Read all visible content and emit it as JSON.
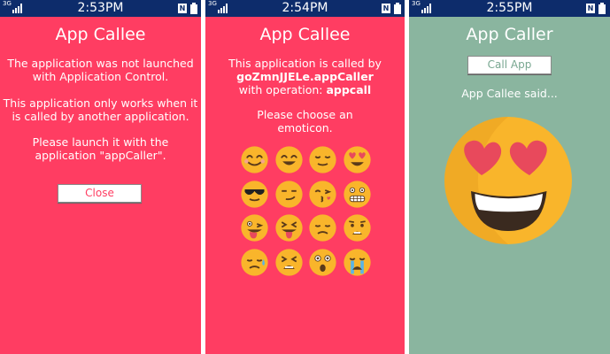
{
  "colors": {
    "callee_bg": "#ff3d62",
    "caller_bg": "#8ab59f",
    "statusbar": "#0d2c6b",
    "emoji_face": "#f9b52b",
    "heart": "#e8495c"
  },
  "screens": [
    {
      "statusbar": {
        "network": "3G",
        "time": "2:53PM",
        "n_badge": "N"
      },
      "title": "App Callee",
      "messages": [
        "The application was not launched",
        "with Application Control.",
        "This application only works when it",
        "is called by another application.",
        "Please launch it with the",
        "application \"appCaller\"."
      ],
      "button": "Close"
    },
    {
      "statusbar": {
        "network": "3G",
        "time": "2:54PM",
        "n_badge": "N"
      },
      "title": "App Callee",
      "line1": "This application is called by",
      "caller_id": "goZmnJJELe.appCaller",
      "operation_prefix": "with operation: ",
      "operation": "appcall",
      "prompt_line1": "Please choose an",
      "prompt_line2": "emoticon.",
      "emoticons": [
        "smiling-face-icon",
        "happy-face-icon",
        "relieved-face-icon",
        "heart-eyes-face-icon",
        "sunglasses-face-icon",
        "smirking-face-icon",
        "kissing-face-icon",
        "grimacing-face-icon",
        "winking-tongue-face-icon",
        "squinting-tongue-face-icon",
        "disappointed-face-icon",
        "frowning-face-icon",
        "sad-sweat-face-icon",
        "tired-face-icon",
        "astonished-face-icon",
        "crying-face-icon"
      ]
    },
    {
      "statusbar": {
        "network": "3G",
        "time": "2:55PM",
        "n_badge": "N"
      },
      "title": "App Caller",
      "button": "Call App",
      "result_label": "App Callee said...",
      "result_icon": "heart-eyes-face-icon"
    }
  ]
}
